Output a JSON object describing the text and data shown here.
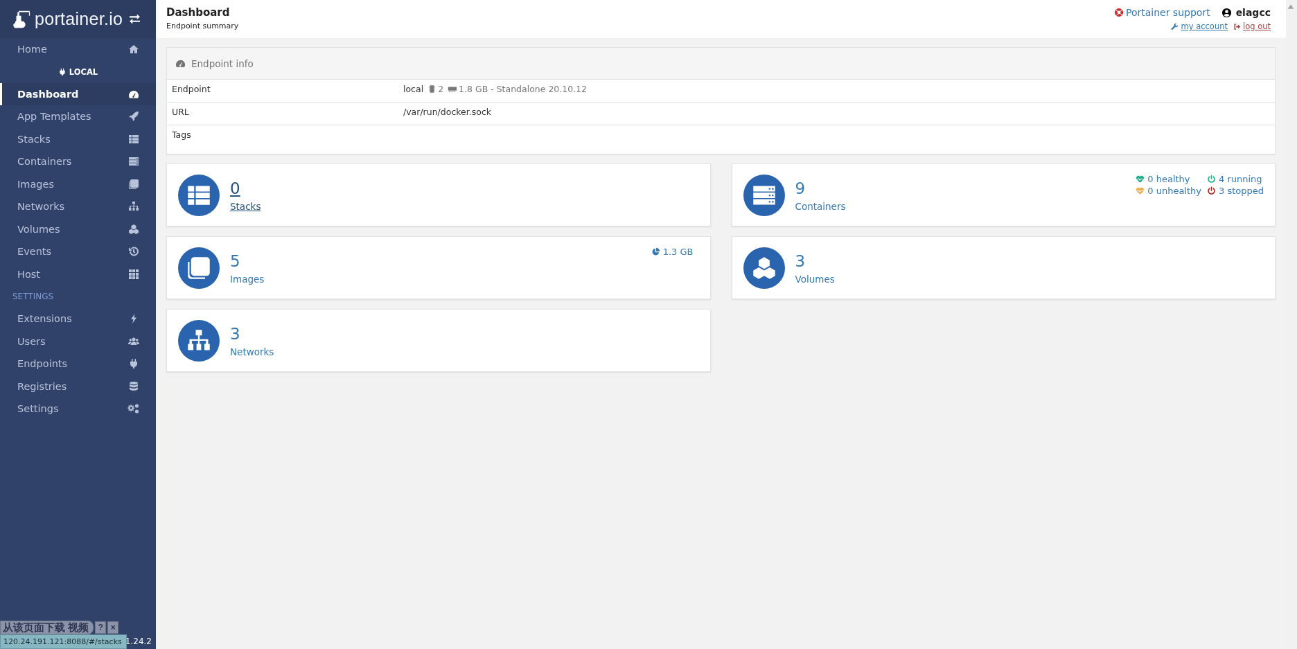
{
  "sidebar": {
    "logo": "portainer.io",
    "items": [
      {
        "label": "Home",
        "kind": "home",
        "selected": false
      }
    ],
    "endpoint": {
      "label": "LOCAL",
      "items": [
        {
          "label": "Dashboard",
          "kind": "gauge",
          "selected": true
        },
        {
          "label": "App Templates",
          "kind": "rocket",
          "selected": false
        },
        {
          "label": "Stacks",
          "kind": "list",
          "selected": false
        },
        {
          "label": "Containers",
          "kind": "server",
          "selected": false
        },
        {
          "label": "Images",
          "kind": "copy",
          "selected": false
        },
        {
          "label": "Networks",
          "kind": "sitemap",
          "selected": false
        },
        {
          "label": "Volumes",
          "kind": "cubes",
          "selected": false
        },
        {
          "label": "Events",
          "kind": "history",
          "selected": false
        },
        {
          "label": "Host",
          "kind": "grid",
          "selected": false
        }
      ]
    },
    "settings": {
      "heading": "SETTINGS",
      "items": [
        {
          "label": "Extensions",
          "kind": "bolt",
          "selected": false
        },
        {
          "label": "Users",
          "kind": "users",
          "selected": false
        },
        {
          "label": "Endpoints",
          "kind": "plug",
          "selected": false
        },
        {
          "label": "Registries",
          "kind": "database",
          "selected": false
        },
        {
          "label": "Settings",
          "kind": "gears",
          "selected": false
        }
      ]
    },
    "version": "1.24.2"
  },
  "header": {
    "title": "Dashboard",
    "subtitle": "Endpoint summary",
    "support": "Portainer support",
    "user": "elagcc",
    "my_account": "my account",
    "log_out": "log out"
  },
  "endpoint_info": {
    "title": "Endpoint info",
    "rows": [
      {
        "kind": "endpoint",
        "label": "Endpoint",
        "value": "local",
        "cpu": "2",
        "memory": "1.8 GB - Standalone 20.10.12"
      },
      {
        "kind": "text",
        "label": "URL",
        "value": "/var/run/docker.sock"
      },
      {
        "kind": "tall",
        "label": "Tags"
      }
    ]
  },
  "cards": [
    {
      "kind": "list",
      "count": "0",
      "label": "Stacks",
      "hovered": true
    },
    {
      "kind": "server",
      "count": "9",
      "label": "Containers",
      "hovered": false,
      "stats": [
        {
          "kind": "healthy",
          "text": "0 healthy"
        },
        {
          "kind": "running",
          "text": "4 running"
        },
        {
          "kind": "unhealthy",
          "text": "0 unhealthy"
        },
        {
          "kind": "stopped",
          "text": "3 stopped"
        }
      ]
    },
    {
      "kind": "copy",
      "count": "5",
      "label": "Images",
      "hovered": false,
      "size": "1.3 GB"
    },
    {
      "kind": "cubes",
      "count": "3",
      "label": "Volumes",
      "hovered": false
    },
    {
      "kind": "sitemap",
      "count": "3",
      "label": "Networks",
      "hovered": false
    }
  ],
  "download_overlay": {
    "label": "从该页面下载 视频",
    "help": "?",
    "close": "×"
  },
  "status_url": "120.24.191.121:8088/#/stacks"
}
